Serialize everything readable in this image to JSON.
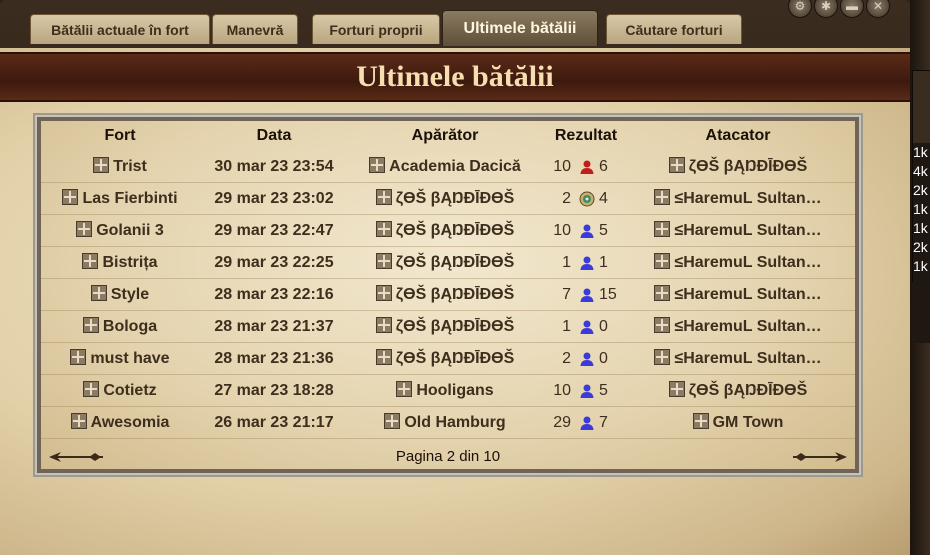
{
  "tabs": [
    {
      "label": "Bătălii actuale în fort"
    },
    {
      "label": "Manevră"
    },
    {
      "label": "Forturi proprii"
    },
    {
      "label": "Ultimele bătălii"
    },
    {
      "label": "Căutare forturi"
    }
  ],
  "page_title": "Ultimele bătălii",
  "table": {
    "headers": [
      "Fort",
      "Data",
      "Apărător",
      "Rezultat",
      "Atacator"
    ],
    "rows": [
      {
        "fort": "Trist",
        "date": "30 mar 23 23:54",
        "defender": "Academia Dacică",
        "res_def": "10",
        "res_att": "6",
        "result_icon": "red-attacker-icon",
        "attacker": "ζϴŠ βĄŊĐĪĐϴŠ"
      },
      {
        "fort": "Las Fierbinti",
        "date": "29 mar 23 23:02",
        "defender": "ζϴŠ βĄŊĐĪĐϴŠ",
        "res_def": "2",
        "res_att": "4",
        "result_icon": "compass-icon",
        "attacker": "≤HaremuL Sultan…"
      },
      {
        "fort": "Golanii 3",
        "date": "29 mar 23 22:47",
        "defender": "ζϴŠ βĄŊĐĪĐϴŠ",
        "res_def": "10",
        "res_att": "5",
        "result_icon": "blue-defender-icon",
        "attacker": "≤HaremuL Sultan…"
      },
      {
        "fort": "Bistrița",
        "date": "29 mar 23 22:25",
        "defender": "ζϴŠ βĄŊĐĪĐϴŠ",
        "res_def": "1",
        "res_att": "1",
        "result_icon": "blue-defender-icon",
        "attacker": "≤HaremuL Sultan…"
      },
      {
        "fort": "Style",
        "date": "28 mar 23 22:16",
        "defender": "ζϴŠ βĄŊĐĪĐϴŠ",
        "res_def": "7",
        "res_att": "15",
        "result_icon": "blue-defender-icon",
        "attacker": "≤HaremuL Sultan…"
      },
      {
        "fort": "Bologa",
        "date": "28 mar 23 21:37",
        "defender": "ζϴŠ βĄŊĐĪĐϴŠ",
        "res_def": "1",
        "res_att": "0",
        "result_icon": "blue-defender-icon",
        "attacker": "≤HaremuL Sultan…"
      },
      {
        "fort": "must have",
        "date": "28 mar 23 21:36",
        "defender": "ζϴŠ βĄŊĐĪĐϴŠ",
        "res_def": "2",
        "res_att": "0",
        "result_icon": "blue-defender-icon",
        "attacker": "≤HaremuL Sultan…"
      },
      {
        "fort": "Cotietz",
        "date": "27 mar 23 18:28",
        "defender": "Hooligans",
        "res_def": "10",
        "res_att": "5",
        "result_icon": "blue-defender-icon",
        "attacker": "ζϴŠ βĄŊĐĪĐϴŠ"
      },
      {
        "fort": "Awesomia",
        "date": "26 mar 23 21:17",
        "defender": "Old Hamburg",
        "res_def": "29",
        "res_att": "7",
        "result_icon": "blue-defender-icon",
        "attacker": "GM Town"
      }
    ]
  },
  "pager": {
    "text": "Pagina 2 din 10"
  },
  "side_list": [
    "1k",
    "4k",
    "2k",
    "1k",
    "1k",
    "2k",
    "1k"
  ],
  "colors": {
    "banner": "#4a2212",
    "title": "#f7deb0",
    "defender_win": "#3b3bd6",
    "attacker_win": "#c21d1d"
  }
}
